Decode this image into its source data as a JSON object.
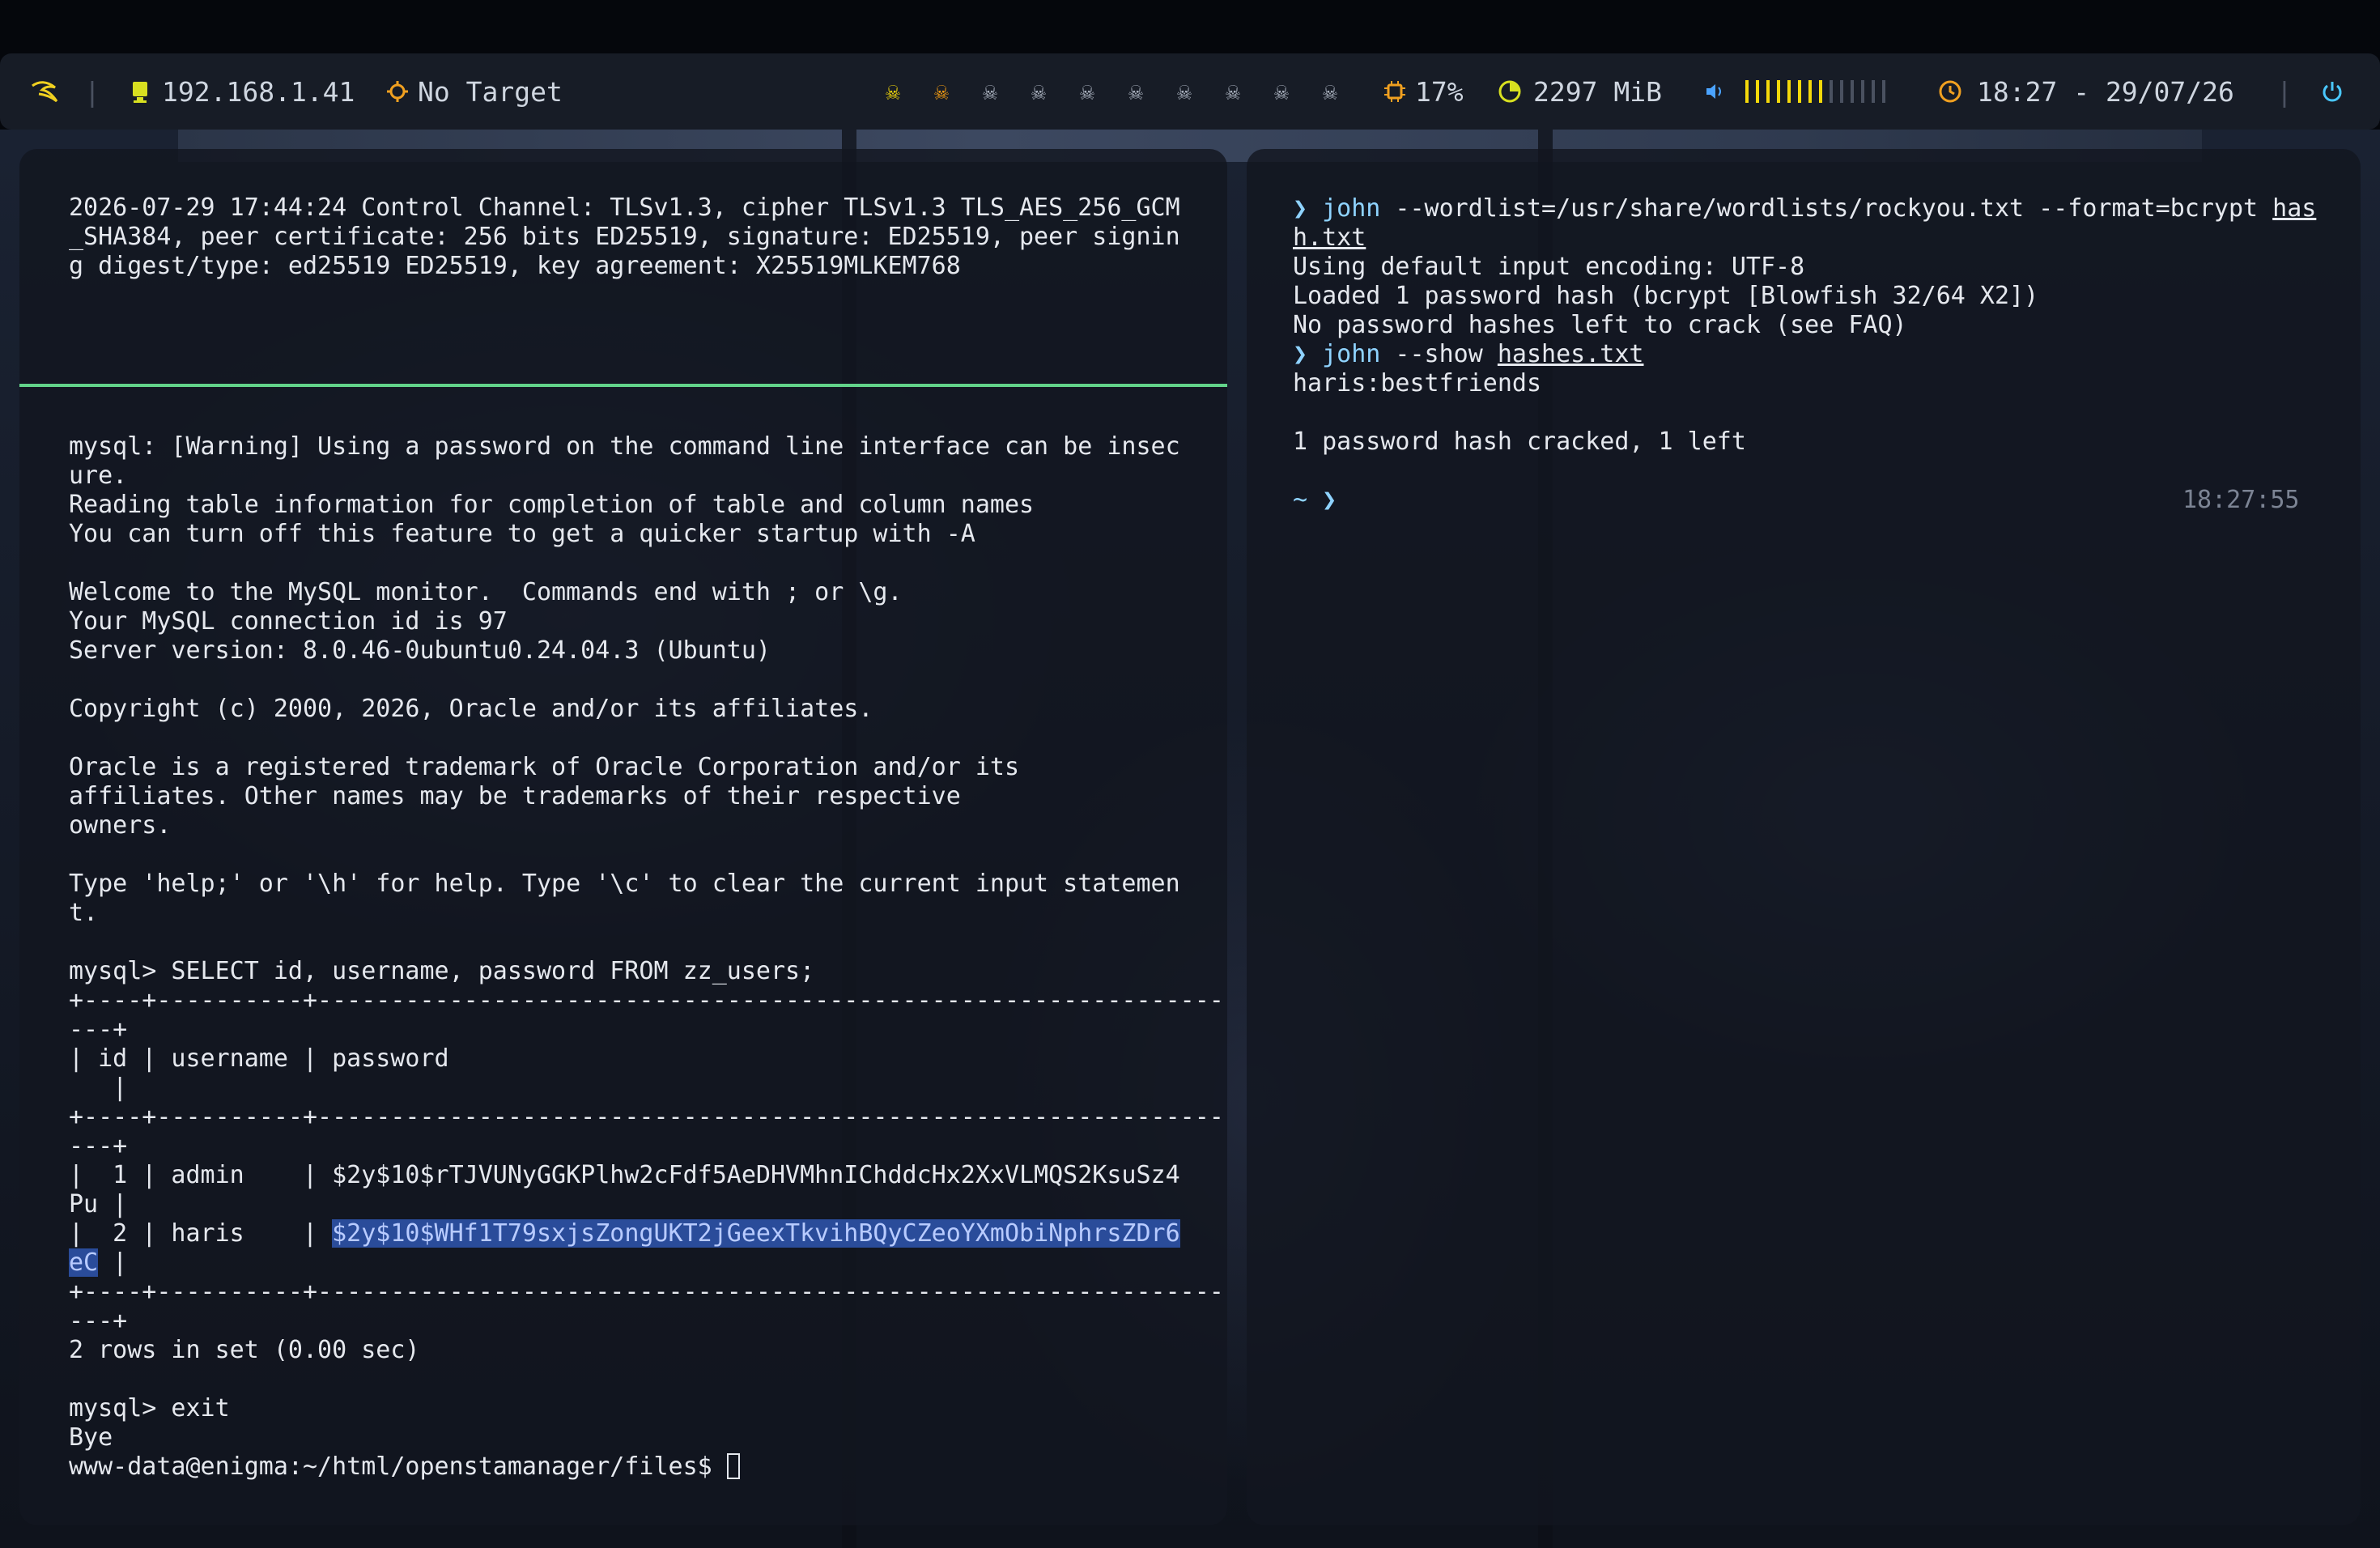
{
  "topbar": {
    "ip": "192.168.1.41",
    "target": "No Target",
    "workspaces": 10,
    "workspace_active": 1,
    "cpu": "17%",
    "memory": "2297 MiB",
    "volume_level": 0.6,
    "datetime": "18:27 - 29/07/26",
    "colors": {
      "active": "#f5d90a",
      "occupied": "#f39c12",
      "idle": "#aab2bf",
      "ok": "#6ee07a",
      "cpu": "#f0a020"
    }
  },
  "left_top": {
    "lines": [
      "2026-07-29 17:44:24 Control Channel: TLSv1.3, cipher TLSv1.3 TLS_AES_256_GCM",
      "_SHA384, peer certificate: 256 bits ED25519, signature: ED25519, peer signin",
      "g digest/type: ed25519 ED25519, key agreement: X25519MLKEM768"
    ]
  },
  "left_bottom": {
    "lines": [
      "mysql: [Warning] Using a password on the command line interface can be insec",
      "ure.",
      "Reading table information for completion of table and column names",
      "You can turn off this feature to get a quicker startup with -A",
      "",
      "Welcome to the MySQL monitor.  Commands end with ; or \\g.",
      "Your MySQL connection id is 97",
      "Server version: 8.0.46-0ubuntu0.24.04.3 (Ubuntu)",
      "",
      "Copyright (c) 2000, 2026, Oracle and/or its affiliates.",
      "",
      "Oracle is a registered trademark of Oracle Corporation and/or its",
      "affiliates. Other names may be trademarks of their respective",
      "owners.",
      "",
      "Type 'help;' or '\\h' for help. Type '\\c' to clear the current input statemen",
      "t.",
      "",
      "mysql> SELECT id, username, password FROM zz_users;",
      "+----+----------+--------------------------------------------------------------",
      "---+",
      "| id | username | password",
      "   |",
      "+----+----------+--------------------------------------------------------------",
      "---+",
      "|  1 | admin    | $2y$10$rTJVUNyGGKPlhw2cFdf5AeDHVMhnIChddcHx2XxVLMQS2KsuSz4",
      "Pu |"
    ],
    "row2_prefix": "|  2 | haris    | ",
    "row2_hash_a": "$2y$10$WHf1T79sxjsZongUKT2jGeexTkvihBQyCZeoYXmObiNphrsZDr6",
    "row2_hash_b": "eC",
    "row2_suffix": " |",
    "tail": [
      "+----+----------+--------------------------------------------------------------",
      "---+",
      "2 rows in set (0.00 sec)",
      "",
      "mysql> exit",
      "Bye"
    ],
    "prompt": "www-data@enigma:~/html/openstamanager/files$ "
  },
  "right": {
    "prompt_glyph": "❯",
    "cmd1_name": "john",
    "cmd1_args": " --wordlist=/usr/share/wordlists/rockyou.txt --format=bcrypt ",
    "cmd1_file_a": "has",
    "cmd1_file_b": "h.txt",
    "out1": [
      "Using default input encoding: UTF-8",
      "Loaded 1 password hash (bcrypt [Blowfish 32/64 X2])",
      "No password hashes left to crack (see FAQ)"
    ],
    "cmd2_name": "john",
    "cmd2_args": " --show ",
    "cmd2_file": "hashes.txt",
    "out2": [
      "haris:bestfriends",
      "",
      "1 password hash cracked, 1 left"
    ],
    "cwd": "~",
    "timestamp": "18:27:55"
  }
}
